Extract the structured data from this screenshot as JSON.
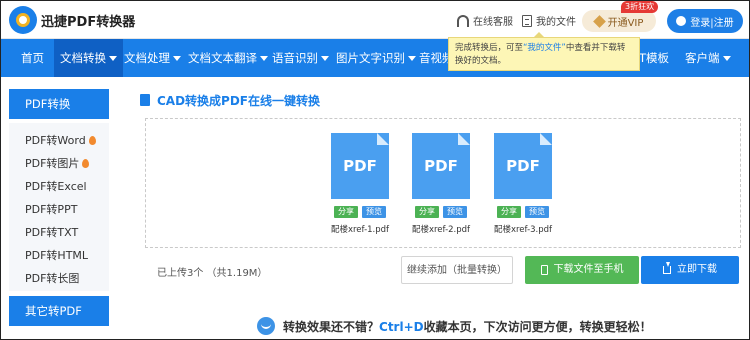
{
  "header": {
    "brand": "迅捷PDF转换器",
    "service_link": "在线客服",
    "files_link": "我的文件",
    "vip_label": "开通VIP",
    "vip_badge": "3折狂欢",
    "login_label": "登录|注册"
  },
  "tooltip": {
    "before": "完成转换后，可至",
    "highlight": "“我的文件”",
    "after": "中查看并下载转换好的文档。"
  },
  "nav": {
    "items": [
      {
        "label": "首页",
        "dropdown": false
      },
      {
        "label": "文档转换",
        "dropdown": true,
        "active": true
      },
      {
        "label": "文档处理",
        "dropdown": true
      },
      {
        "label": "文档文本翻译",
        "dropdown": true
      },
      {
        "label": "语音识别",
        "dropdown": true
      },
      {
        "label": "图片文字识别",
        "dropdown": true
      },
      {
        "label": "音视频",
        "dropdown": false
      },
      {
        "label": "T模板",
        "dropdown": false
      },
      {
        "label": "客户端",
        "dropdown": true
      }
    ]
  },
  "sidebar": {
    "head": "PDF转换",
    "items": [
      {
        "label": "PDF转Word",
        "hot": true
      },
      {
        "label": "PDF转图片",
        "hot": true
      },
      {
        "label": "PDF转Excel",
        "hot": false
      },
      {
        "label": "PDF转PPT",
        "hot": false
      },
      {
        "label": "PDF转TXT",
        "hot": false
      },
      {
        "label": "PDF转HTML",
        "hot": false
      },
      {
        "label": "PDF转长图",
        "hot": false
      }
    ],
    "foot": "其它转PDF"
  },
  "main": {
    "title": "CAD转换成PDF在线一键转换",
    "files": [
      {
        "icon_text": "PDF",
        "share": "分享",
        "preview": "预览",
        "name": "配楼xref-1.pdf"
      },
      {
        "icon_text": "PDF",
        "share": "分享",
        "preview": "预览",
        "name": "配楼xref-2.pdf"
      },
      {
        "icon_text": "PDF",
        "share": "分享",
        "preview": "预览",
        "name": "配楼xref-3.pdf"
      }
    ],
    "upload_count": "已上传3个 （共1.19M）",
    "add_button": "继续添加（批量转换）",
    "phone_button": "下载文件至手机",
    "download_button": "立即下载"
  },
  "footer": {
    "before": "转换效果还不错？",
    "shortcut": "Ctrl+D",
    "after": "收藏本页，下次访问更方便，转换更轻松！"
  },
  "colors": {
    "primary": "#1a7fe8",
    "nav_active": "#0f60c4",
    "green": "#53b856",
    "file_blue": "#4a9ff0",
    "tooltip_bg": "#fdf6b6",
    "vip_bg": "#f6ebd8"
  }
}
